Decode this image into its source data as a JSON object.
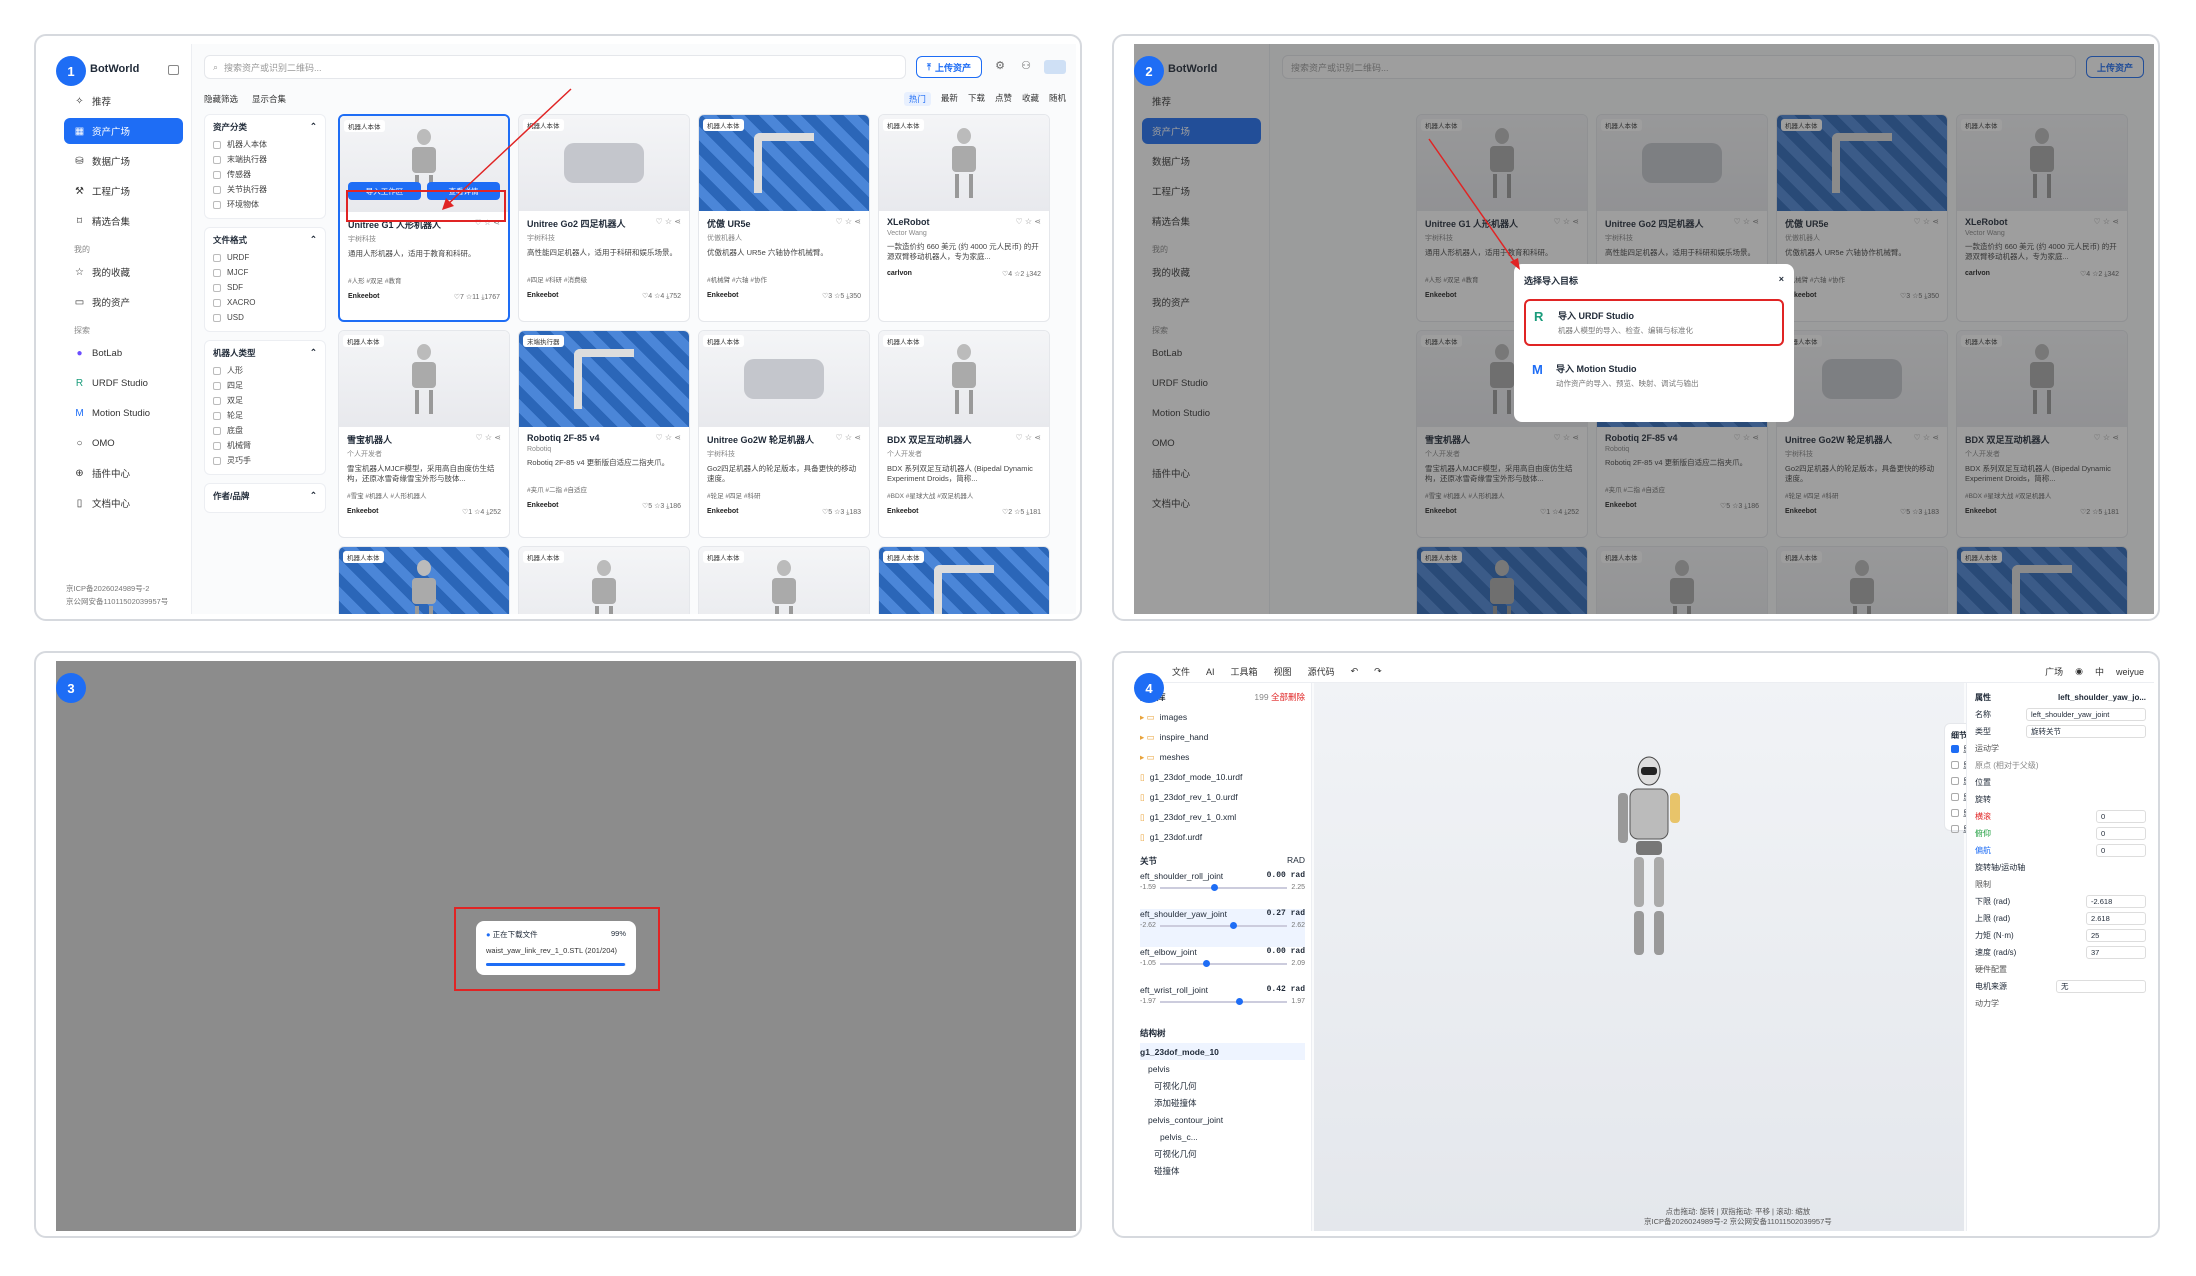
{
  "panel1": {
    "step": "1",
    "logo": "BotWorld",
    "search_placeholder": "搜索资产或识别二维码...",
    "upload": "上传资产",
    "nav": [
      "推荐",
      "资产广场",
      "数据广场",
      "工程广场",
      "精选合集"
    ],
    "mine_label": "我的",
    "mine": [
      "我的收藏",
      "我的资产"
    ],
    "explore_label": "探索",
    "explore": [
      "BotLab",
      "URDF Studio",
      "Motion Studio",
      "OMO",
      "插件中心",
      "文档中心"
    ],
    "footer": [
      "京ICP备2026024989号-2",
      "京公网安备11011502039957号"
    ],
    "filters": {
      "hide": "隐藏筛选",
      "show": "显示合集"
    },
    "sorts": [
      "热门",
      "最新",
      "下载",
      "点赞",
      "收藏",
      "随机"
    ],
    "cat_title": "资产分类",
    "cats": [
      "机器人本体",
      "末端执行器",
      "传感器",
      "关节执行器",
      "环境物体"
    ],
    "fmt_title": "文件格式",
    "fmts": [
      "URDF",
      "MJCF",
      "SDF",
      "XACRO",
      "USD"
    ],
    "type_title": "机器人类型",
    "types": [
      "人形",
      "四足",
      "双足",
      "轮足",
      "底盘",
      "机械臂",
      "灵巧手"
    ],
    "author_title": "作者/品牌",
    "hover": {
      "import": "导入工作区",
      "detail": "查看详情"
    },
    "cards": [
      {
        "tag": "机器人本体",
        "title": "Unitree G1 人形机器人",
        "sub": "宇树科技",
        "desc": "通用人形机器人，适用于教育和科研。",
        "tags": "#人形 #双足 #教育",
        "author": "Enkeebot",
        "stats": "♡7 ☆11 ⤓1767"
      },
      {
        "tag": "机器人本体",
        "title": "Unitree Go2 四足机器人",
        "sub": "宇树科技",
        "desc": "高性能四足机器人，适用于科研和娱乐场景。",
        "tags": "#四足 #科研 #消费级",
        "author": "Enkeebot",
        "stats": "♡4 ☆4 ⤓752"
      },
      {
        "tag": "机器人本体",
        "title": "优傲 UR5e",
        "sub": "优傲机器人",
        "desc": "优傲机器人 UR5e 六轴协作机械臂。",
        "tags": "#机械臂 #六轴 #协作",
        "author": "Enkeebot",
        "stats": "♡3 ☆5 ⤓350"
      },
      {
        "tag": "机器人本体",
        "title": "XLeRobot",
        "sub": "Vector Wang",
        "desc": "一款造价约 660 美元 (约 4000 元人民币) 的开源双臂移动机器人，专为家庭...",
        "tags": "",
        "author": "carlvon",
        "stats": "♡4 ☆2 ⤓342"
      },
      {
        "tag": "机器人本体",
        "title": "雪宝机器人",
        "sub": "个人开发者",
        "desc": "雪宝机器人MJCF模型，采用高自由度仿生结构，还原冰雪奇缘雪宝外形与肢体...",
        "tags": "#雪宝 #机器人 #人形机器人",
        "author": "Enkeebot",
        "stats": "♡1 ☆4 ⤓252"
      },
      {
        "tag": "末端执行器",
        "title": "Robotiq 2F-85 v4",
        "sub": "Robotiq",
        "desc": "Robotiq 2F-85 v4 更新版自适应二指夹爪。",
        "tags": "#夹爪 #二指 #自适应",
        "author": "Enkeebot",
        "stats": "♡5 ☆3 ⤓186"
      },
      {
        "tag": "机器人本体",
        "title": "Unitree Go2W 轮足机器人",
        "sub": "宇树科技",
        "desc": "Go2四足机器人的轮足版本，具备更快的移动速度。",
        "tags": "#轮足 #四足 #科研",
        "author": "Enkeebot",
        "stats": "♡5 ☆3 ⤓183"
      },
      {
        "tag": "机器人本体",
        "title": "BDX 双足互动机器人",
        "sub": "个人开发者",
        "desc": "BDX 系列双足互动机器人 (Bipedal Dynamic Experiment Droids，简称...",
        "tags": "#BDX #星球大战 #双足机器人",
        "author": "Enkeebot",
        "stats": "♡2 ☆5 ⤓181"
      },
      {
        "tag": "机器人本体"
      },
      {
        "tag": "机器人本体"
      },
      {
        "tag": "机器人本体"
      },
      {
        "tag": "机器人本体"
      }
    ]
  },
  "panel2": {
    "step": "2",
    "modal_title": "选择导入目标",
    "opt1": {
      "icon": "R",
      "name": "导入 URDF Studio",
      "desc": "机器人模型的导入、检查、编辑与标准化"
    },
    "opt2": {
      "icon": "M",
      "name": "导入 Motion Studio",
      "desc": "动作资产的导入、预览、映射、调试与输出"
    }
  },
  "panel3": {
    "step": "3",
    "toast_title": "正在下载文件",
    "toast_pct": "99%",
    "toast_file": "waist_yaw_link_rev_1_0.STL (201/204)",
    "progress": 0.99
  },
  "panel4": {
    "step": "4",
    "menu": [
      "文件",
      "AI",
      "工具箱",
      "视图",
      "源代码"
    ],
    "right": [
      "广场",
      "中",
      "weiyue"
    ],
    "lib": {
      "title": "素材库",
      "count": "199",
      "clear": "全部删除",
      "items": [
        "images",
        "inspire_hand",
        "meshes",
        "g1_23dof_mode_10.urdf",
        "g1_23dof_rev_1_0.urdf",
        "g1_23dof_rev_1_0.xml",
        "g1_23dof.urdf"
      ]
    },
    "joints_title": "关节",
    "unit": "RAD",
    "joints": [
      {
        "n": "eft_shoulder_roll_joint",
        "v": "0.00 rad",
        "min": "-1.59",
        "max": "2.25",
        "p": 0.4
      },
      {
        "n": "eft_shoulder_yaw_joint",
        "v": "0.27 rad",
        "min": "-2.62",
        "max": "2.62",
        "p": 0.55
      },
      {
        "n": "eft_elbow_joint",
        "v": "0.00 rad",
        "min": "-1.05",
        "max": "2.09",
        "p": 0.34
      },
      {
        "n": "eft_wrist_roll_joint",
        "v": "0.42 rad",
        "min": "-1.97",
        "max": "1.97",
        "p": 0.6
      }
    ],
    "tree_title": "结构树",
    "tree": [
      "g1_23dof_mode_10",
      "pelvis",
      "可视化几何",
      "添加碰撞体",
      "pelvis_contour_joint",
      "pelvis_c...",
      "可视化几何",
      "碰撞体"
    ],
    "detail": {
      "title": "细节选项",
      "opts": [
        "显示可视化",
        "显示碰撞体",
        "显示坐标系",
        "显示关节轴",
        "显示质心",
        "显示惯量"
      ]
    },
    "props": {
      "title": "属性",
      "link": "left_shoulder_yaw_jo...",
      "name_l": "名称",
      "name_v": "left_shoulder_yaw_joint",
      "type_l": "类型",
      "type_v": "旋转关节",
      "kin": "运动学",
      "origin": "原点 (相对于父级)",
      "pos": "位置",
      "rot": "旋转",
      "x": "横滚",
      "y": "俯仰",
      "z": "偏航",
      "axis": "旋转轴/运动轴",
      "limits": "限制",
      "lower_l": "下限 (rad)",
      "lower": "-2.618",
      "upper_l": "上限 (rad)",
      "upper": "2.618",
      "effort_l": "力矩 (N·m)",
      "effort": "25",
      "vel_l": "速度 (rad/s)",
      "vel": "37",
      "hw": "硬件配置",
      "motor_l": "电机来源",
      "motor": "无",
      "dyn": "动力学"
    },
    "hint": "点击拖动: 旋转 | 双指拖动: 平移 | 滚动: 缩放",
    "footer": "京ICP备2026024989号-2 京公网安备11011502039957号"
  }
}
